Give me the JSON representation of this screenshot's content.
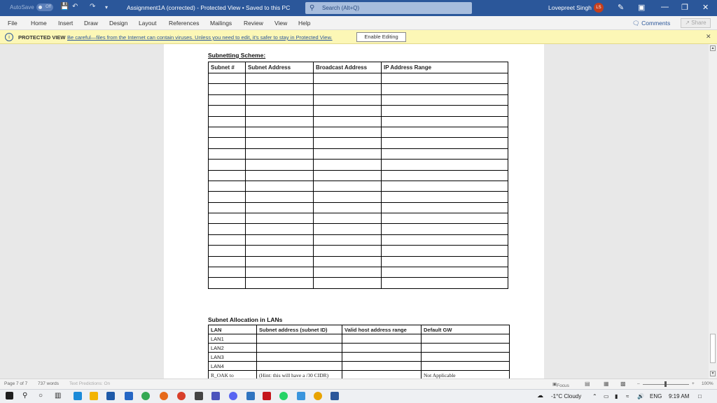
{
  "titlebar": {
    "autosave": "AutoSave",
    "autosave_state": "Off",
    "doc_title": "Assignment1A (corrected)  -  Protected View • Saved to this PC",
    "search_placeholder": "Search (Alt+Q)",
    "user": "Lovepreet Singh",
    "avatar": "LS"
  },
  "menu": {
    "tabs": [
      "File",
      "Home",
      "Insert",
      "Draw",
      "Design",
      "Layout",
      "References",
      "Mailings",
      "Review",
      "View",
      "Help"
    ],
    "comments": "Comments",
    "share": "Share"
  },
  "protected_bar": {
    "title": "PROTECTED VIEW",
    "message": "Be careful—files from the Internet can contain viruses. Unless you need to edit, it's safer to stay in Protected View.",
    "enable_button": "Enable Editing"
  },
  "document": {
    "scheme_heading": "Subnetting Scheme:",
    "scheme_headers": [
      "Subnet #",
      "Subnet Address",
      "Broadcast Address",
      "IP Address Range"
    ],
    "scheme_empty_rows": 20,
    "alloc_heading": "Subnet Allocation in LANs",
    "alloc_headers": [
      "LAN",
      "Subnet address (subnet ID)",
      "Valid host address range",
      "Default GW"
    ],
    "alloc_rows": [
      [
        "LAN1",
        "",
        "",
        ""
      ],
      [
        "LAN2",
        "",
        "",
        ""
      ],
      [
        "LAN3",
        "",
        "",
        ""
      ],
      [
        "LAN4",
        "",
        "",
        ""
      ],
      [
        "R_OAK to",
        "(Hint: this will have a /30 CIDR)",
        "",
        "Not Applicable"
      ]
    ]
  },
  "statusbar": {
    "page": "Page 7 of 7",
    "words": "737 words",
    "predictions": "Text Predictions: On",
    "focus": "Focus",
    "zoom": "100%"
  },
  "taskbar": {
    "weather": "-1°C  Cloudy",
    "lang": "ENG",
    "time": "9:19 AM"
  }
}
